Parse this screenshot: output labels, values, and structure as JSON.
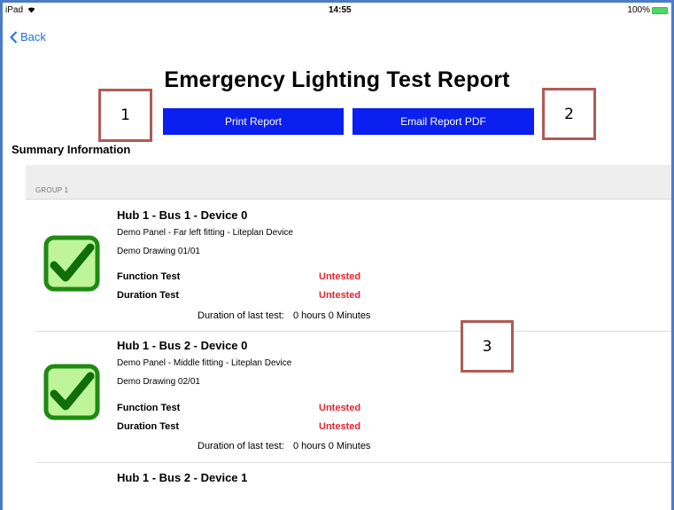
{
  "status_bar": {
    "device": "iPad",
    "time": "14:55",
    "battery": "100%",
    "wifi_icon": "wifi-icon",
    "battery_icon": "battery-icon"
  },
  "nav": {
    "back_label": "Back",
    "back_icon": "chevron-left-icon"
  },
  "page": {
    "title": "Emergency Lighting Test Report",
    "print_label": "Print Report",
    "email_label": "Email Report PDF",
    "section_title": "Summary  Information",
    "accent_color": "#0a1ff0",
    "untested_color": "#e8232f"
  },
  "callouts": [
    "1",
    "2",
    "3"
  ],
  "group": {
    "label": "GROUP 1",
    "devices": [
      {
        "title": "Hub 1 - Bus 1 - Device 0",
        "description": "Demo Panel - Far left fitting - Liteplan Device",
        "drawing": "Demo Drawing 01/01",
        "function_label": "Function Test",
        "function_value": "Untested",
        "duration_label": "Duration Test",
        "duration_value": "Untested",
        "last_test_label": "Duration of last test:",
        "last_test_value": "0 hours 0 Minutes",
        "icon": "checkmark-icon"
      },
      {
        "title": "Hub 1 - Bus 2 - Device 0",
        "description": "Demo Panel - Middle fitting - Liteplan Device",
        "drawing": "Demo Drawing 02/01",
        "function_label": "Function Test",
        "function_value": "Untested",
        "duration_label": "Duration Test",
        "duration_value": "Untested",
        "last_test_label": "Duration of last test:",
        "last_test_value": "0 hours 0 Minutes",
        "icon": "checkmark-icon"
      },
      {
        "title": "Hub 1 - Bus 2 - Device 1"
      }
    ]
  }
}
